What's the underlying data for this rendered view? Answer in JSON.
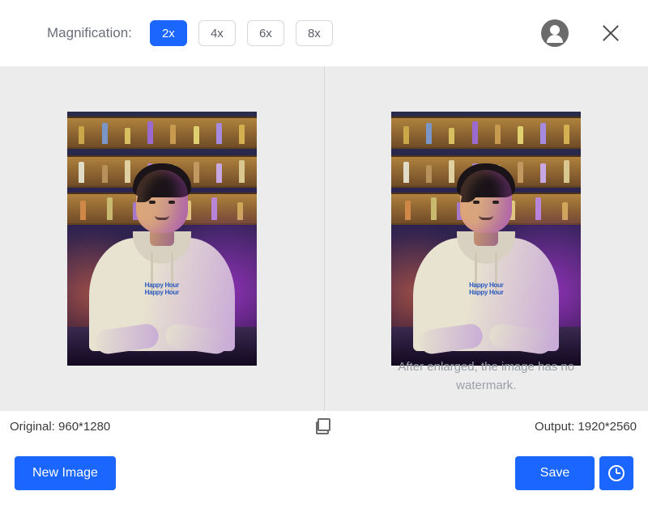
{
  "header": {
    "magnification_label": "Magnification:",
    "options": [
      "2x",
      "4x",
      "6x",
      "8x"
    ],
    "active_option": "2x"
  },
  "preview": {
    "watermark_notice_line1": "After enlarged, the image has no",
    "watermark_notice_line2": "watermark.",
    "hoodie_text_line1": "Happy Hour",
    "hoodie_text_line2": "Happy Hour"
  },
  "info": {
    "original_label": "Original:",
    "original_resolution": "960*1280",
    "output_label": "Output:",
    "output_resolution": "1920*2560"
  },
  "footer": {
    "new_image_label": "New Image",
    "save_label": "Save"
  },
  "colors": {
    "primary": "#1b66ff"
  }
}
